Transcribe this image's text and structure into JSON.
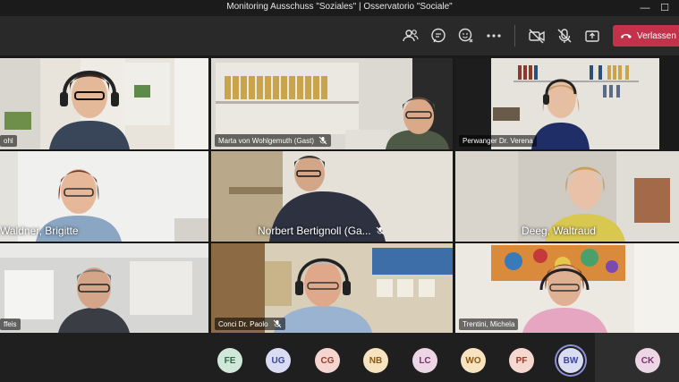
{
  "window": {
    "title": "Monitoring Ausschuss \"Soziales\" | Osservatorio \"Sociale\"",
    "minimize_glyph": "—",
    "maximize_glyph": "☐"
  },
  "toolbar": {
    "leave_label": "Verlassen",
    "icons": [
      "participants-icon",
      "chat-icon",
      "reactions-icon",
      "more-icon",
      "camera-off-icon",
      "mic-off-icon",
      "share-icon"
    ]
  },
  "tiles": [
    {
      "name": "ohl",
      "muted": false
    },
    {
      "name": "Marta von Wohlgemuth (Gast)",
      "muted": true
    },
    {
      "name": "Perwanger Dr. Verena",
      "muted": false
    },
    {
      "name": "Waldner, Brigitte",
      "muted": false
    },
    {
      "name": "Norbert Bertignoll (Ga...",
      "muted": true
    },
    {
      "name": "Deeg, Waltraud",
      "muted": false
    },
    {
      "name": "ffeis",
      "muted": false
    },
    {
      "name": "Conci Dr. Paolo",
      "muted": true
    },
    {
      "name": "Trentini, Michela",
      "muted": false
    }
  ],
  "participants": [
    {
      "initials": "FE",
      "bg": "#cfe8d9",
      "fg": "#2e6b46"
    },
    {
      "initials": "UG",
      "bg": "#d9dcf2",
      "fg": "#3c4799"
    },
    {
      "initials": "CG",
      "bg": "#f5d5d0",
      "fg": "#9a3a2c"
    },
    {
      "initials": "NB",
      "bg": "#f7e3bf",
      "fg": "#8a5a12"
    },
    {
      "initials": "LC",
      "bg": "#ecd6e6",
      "fg": "#7c2f6b"
    },
    {
      "initials": "WO",
      "bg": "#f7e3bf",
      "fg": "#8a5a12"
    },
    {
      "initials": "PF",
      "bg": "#f5d8d0",
      "fg": "#9a3a2c"
    },
    {
      "initials": "BW",
      "bg": "#d9dcf2",
      "fg": "#3c4799"
    },
    {
      "initials": "CK",
      "bg": "#ecd6e6",
      "fg": "#7c2f6b"
    }
  ]
}
